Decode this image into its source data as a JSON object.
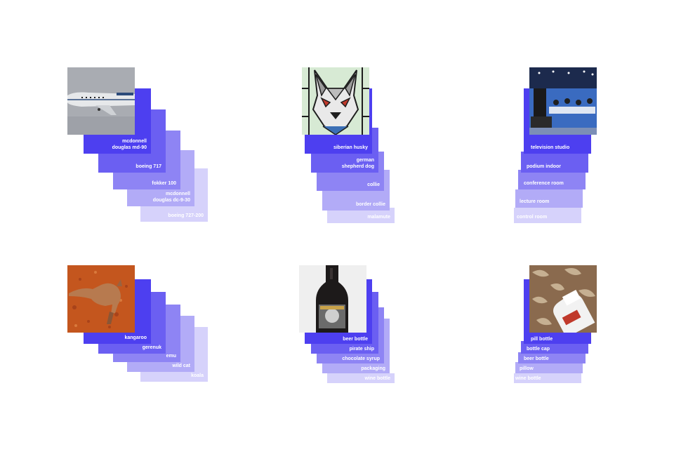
{
  "groups": [
    {
      "id": "airplane",
      "labels": [
        "mcdonnell douglas md-90",
        "boeing 717",
        "fokker 100",
        "mcdonnell douglas dc-9-30",
        "boeing 727-200"
      ],
      "label_lines": [
        [
          "mcdonnell",
          "douglas md-90"
        ],
        [
          "boeing 717"
        ],
        [
          "fokker 100"
        ],
        [
          "mcdonnell",
          "douglas dc-9-30"
        ],
        [
          "boeing 727-200"
        ]
      ],
      "scores": [
        1.0,
        0.8,
        0.6,
        0.4,
        0.2
      ],
      "photo": "airplane-photo"
    },
    {
      "id": "husky",
      "labels": [
        "siberian husky",
        "german shepherd dog",
        "collie",
        "border collie",
        "malamute"
      ],
      "label_lines": [
        [
          "siberian husky"
        ],
        [
          "german",
          "shepherd dog"
        ],
        [
          "collie"
        ],
        [
          "border collie"
        ],
        [
          "malamute"
        ]
      ],
      "scores": [
        1.0,
        0.8,
        0.6,
        0.4,
        0.2
      ],
      "photo": "stained-glass-dog-photo"
    },
    {
      "id": "studio",
      "labels": [
        "television studio",
        "podium indoor",
        "conference room",
        "lecture room",
        "control room"
      ],
      "label_lines": [
        [
          "television studio"
        ],
        [
          "podium indoor"
        ],
        [
          "conference room"
        ],
        [
          "lecture room"
        ],
        [
          "control room"
        ]
      ],
      "scores": [
        1.0,
        0.8,
        0.6,
        0.4,
        0.2
      ],
      "photo": "tv-studio-photo"
    },
    {
      "id": "kangaroo",
      "labels": [
        "kangaroo",
        "gerenuk",
        "emu",
        "wild cat",
        "koala"
      ],
      "label_lines": [
        [
          "kangaroo"
        ],
        [
          "gerenuk"
        ],
        [
          "emu"
        ],
        [
          "wild cat"
        ],
        [
          "koala"
        ]
      ],
      "scores": [
        1.0,
        0.8,
        0.6,
        0.4,
        0.2
      ],
      "photo": "kangaroo-photo"
    },
    {
      "id": "beer",
      "labels": [
        "beer bottle",
        "pirate ship",
        "chocolate syrup",
        "packaging",
        "wine bottle"
      ],
      "label_lines": [
        [
          "beer bottle"
        ],
        [
          "pirate ship"
        ],
        [
          "chocolate syrup"
        ],
        [
          "packaging"
        ],
        [
          "wine bottle"
        ]
      ],
      "scores": [
        1.0,
        0.8,
        0.6,
        0.4,
        0.2
      ],
      "photo": "beer-bottle-photo"
    },
    {
      "id": "pill",
      "labels": [
        "pill bottle",
        "bottle cap",
        "beer bottle",
        "pillow",
        "wine bottle"
      ],
      "label_lines": [
        [
          "pill bottle"
        ],
        [
          "bottle cap"
        ],
        [
          "beer bottle"
        ],
        [
          "pillow"
        ],
        [
          "wine bottle"
        ]
      ],
      "scores": [
        1.0,
        0.8,
        0.6,
        0.4,
        0.2
      ],
      "photo": "pill-bottle-photo"
    }
  ],
  "colors": [
    "#4d3ff0",
    "#6b5ff2",
    "#8e84f4",
    "#b2abf7",
    "#d6d2fb"
  ]
}
